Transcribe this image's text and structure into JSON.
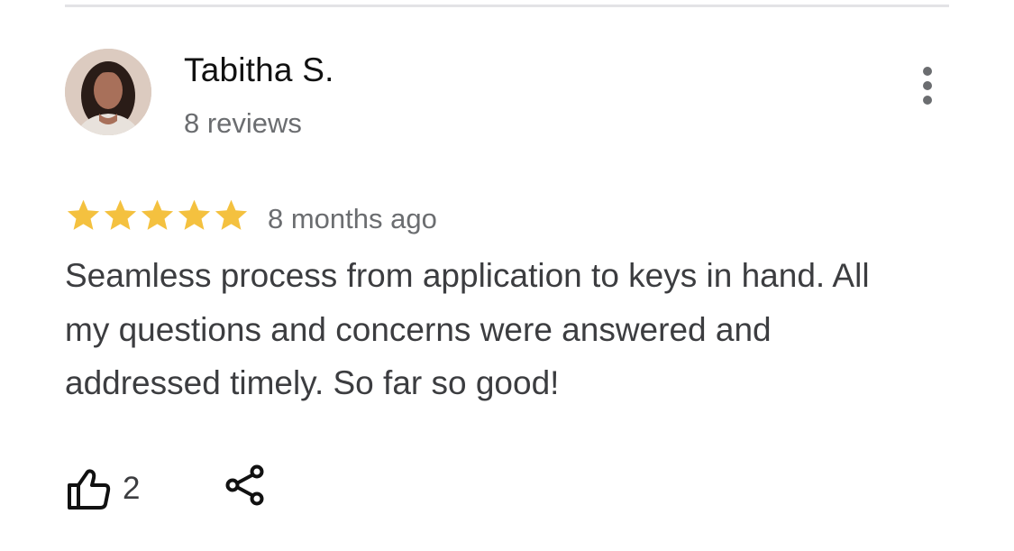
{
  "review": {
    "reviewer_name": "Tabitha S.",
    "review_count": "8 reviews",
    "rating": 5,
    "rating_max": 5,
    "time_ago": "8 months ago",
    "text": "Seamless process from application to keys in hand. All my questions and concerns were answered and addressed timely. So far so good!",
    "like_count": "2"
  },
  "icons": {
    "avatar": "avatar-photo",
    "more": "more-vertical-icon",
    "star": "star-icon",
    "like": "thumbs-up-icon",
    "share": "share-icon"
  },
  "colors": {
    "star": "#f4c13f",
    "name": "#111111",
    "secondary_text": "#6b6d70",
    "body_text": "#3c3d40",
    "divider": "#e3e3e6"
  }
}
